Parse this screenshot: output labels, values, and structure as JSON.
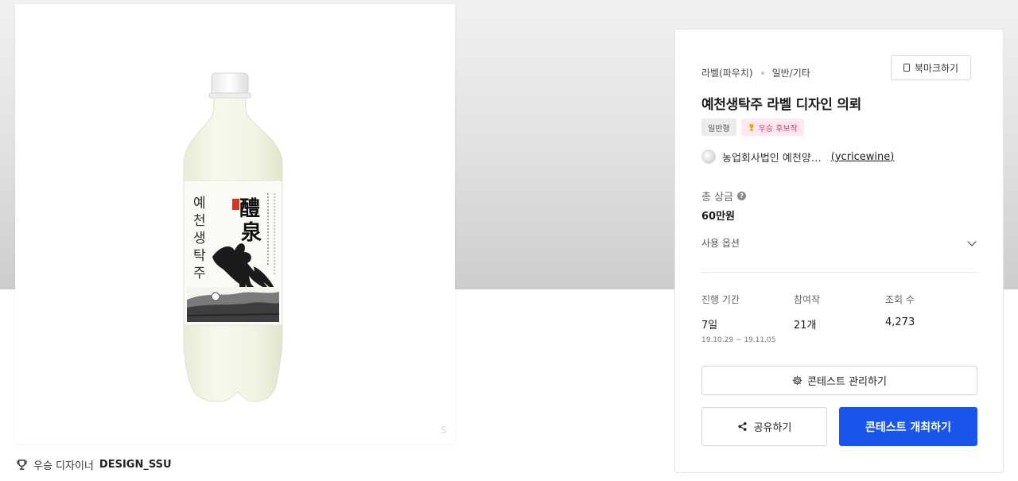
{
  "colors": {
    "accent": "#1a56ec",
    "award_tag_bg": "#fde8ef",
    "award_tag_text": "#d6336c",
    "panel_border": "#e3e3e3"
  },
  "winner": {
    "prefix": "우승 디자이너",
    "name": "DESIGN_SSU",
    "icon": "trophy-icon"
  },
  "product_image": {
    "label_text": [
      "예",
      "천",
      "생",
      "탁",
      "주"
    ],
    "hanja_text": [
      "醴",
      "泉"
    ]
  },
  "contest": {
    "category": "라벨(파우치)",
    "subcategory": "일반/기타",
    "bookmark_label": "북마크하기",
    "title": "예천생탁주 라벨 디자인 의뢰",
    "tags": {
      "type": "일반형",
      "award": "우승 후보작"
    },
    "host": {
      "name": "농업회사법인 예천양…",
      "id": "(ycricewine)"
    },
    "prize": {
      "label": "총 상금",
      "value": "60만원"
    },
    "usage_label": "사용 옵션",
    "stats": {
      "period_label": "진행 기간",
      "period_value": "7일",
      "period_dates": "19.10.29 ~ 19.11.05",
      "entries_label": "참여작",
      "entries_value": "21개",
      "views_label": "조회 수",
      "views_value": "4,273"
    },
    "manage_label": "콘테스트 관리하기",
    "share_label": "공유하기",
    "host_contest_label": "콘테스트 개최하기"
  }
}
